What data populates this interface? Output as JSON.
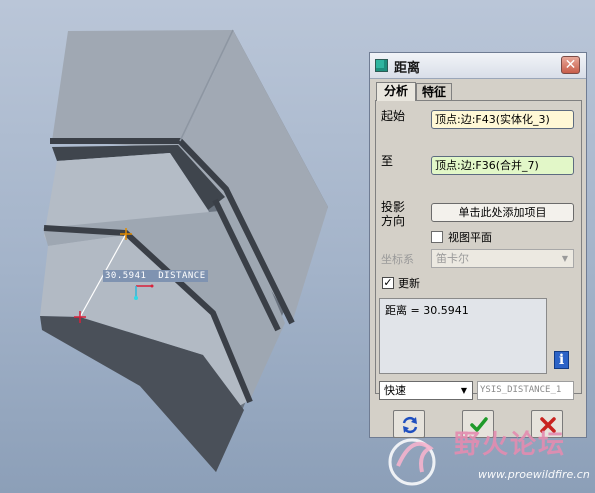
{
  "dialog": {
    "title": "距离",
    "close_glyph": "✕",
    "tabs": [
      {
        "label": "分析",
        "active": true
      },
      {
        "label": "特征",
        "active": false
      }
    ],
    "from_label": "起始",
    "from_value": "顶点:边:F43(实体化_3)",
    "to_label": "至",
    "to_value": "顶点:边:F36(合并_7)",
    "projection_label_1": "投影",
    "projection_label_2": "方向",
    "add_button_label": "单击此处添加项目",
    "view_plane_label": "视图平面",
    "view_plane_checked": false,
    "coord_label": "坐标系",
    "coord_value": "笛卡尔",
    "update_label": "更新",
    "update_checked": true,
    "check_glyph": "✓",
    "result_text": "距离 = 30.5941",
    "info_glyph": "i",
    "speed_value": "快速",
    "combo_arrow": "▼",
    "name_value": "YSIS_DISTANCE_1",
    "buttons": [
      "repeat-icon",
      "ok-check-icon",
      "cancel-x-icon"
    ]
  },
  "viewport": {
    "measurement_label": "30.5941  DISTANCE"
  },
  "watermark": {
    "brand_text": "野火论坛",
    "url_text": "www.proewildfire.cn"
  },
  "colors": {
    "accent_teal": "#2fb5a0",
    "field_yellow": "#fff8d6",
    "field_green": "#e2f7c8",
    "ok_green": "#1f9a2a",
    "cancel_red": "#c8231f"
  }
}
